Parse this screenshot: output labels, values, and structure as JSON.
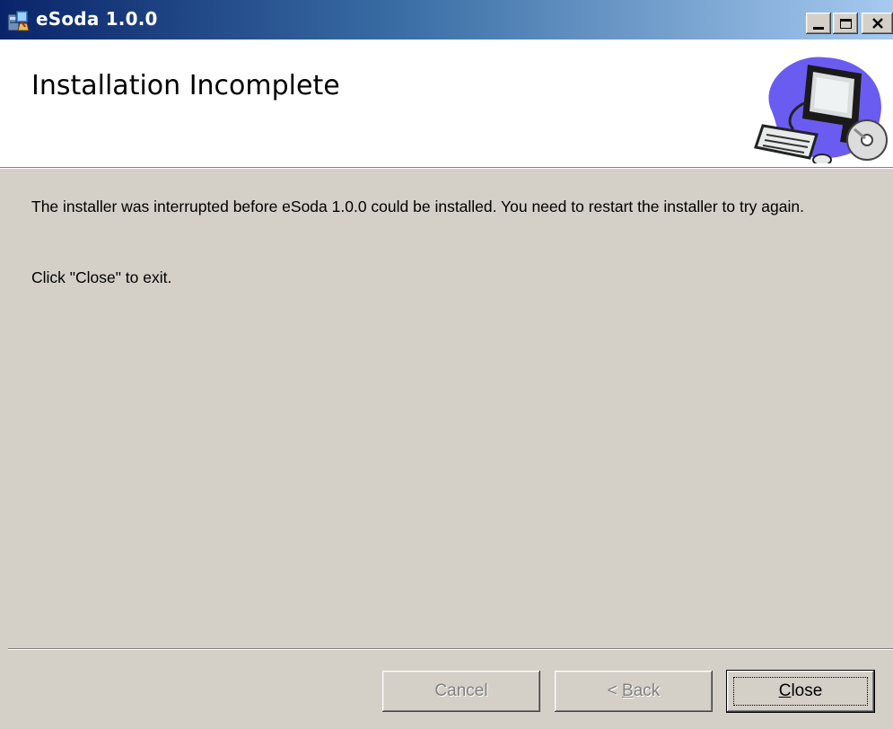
{
  "window": {
    "title": "eSoda 1.0.0",
    "controls": [
      "minimize-icon",
      "maximize-icon",
      "close-icon"
    ]
  },
  "banner": {
    "title": "Installation Incomplete",
    "art_icon": "computer-with-cd-icon"
  },
  "body": {
    "message": "The installer was interrupted before eSoda 1.0.0 could be installed. You need to restart the installer to try again.",
    "instruction": "Click \"Close\" to exit."
  },
  "buttons": {
    "cancel": {
      "label": "Cancel",
      "enabled": false
    },
    "back": {
      "prefix": "< ",
      "mnemonic": "B",
      "rest": "ack",
      "enabled": false
    },
    "close": {
      "mnemonic": "C",
      "rest": "lose",
      "enabled": true,
      "focused": true
    }
  },
  "colors": {
    "titlebar_start": "#0a246a",
    "titlebar_end": "#a6caf0",
    "face": "#d4d0c8",
    "banner_bg": "#ffffff",
    "disabled_text": "#808080"
  }
}
